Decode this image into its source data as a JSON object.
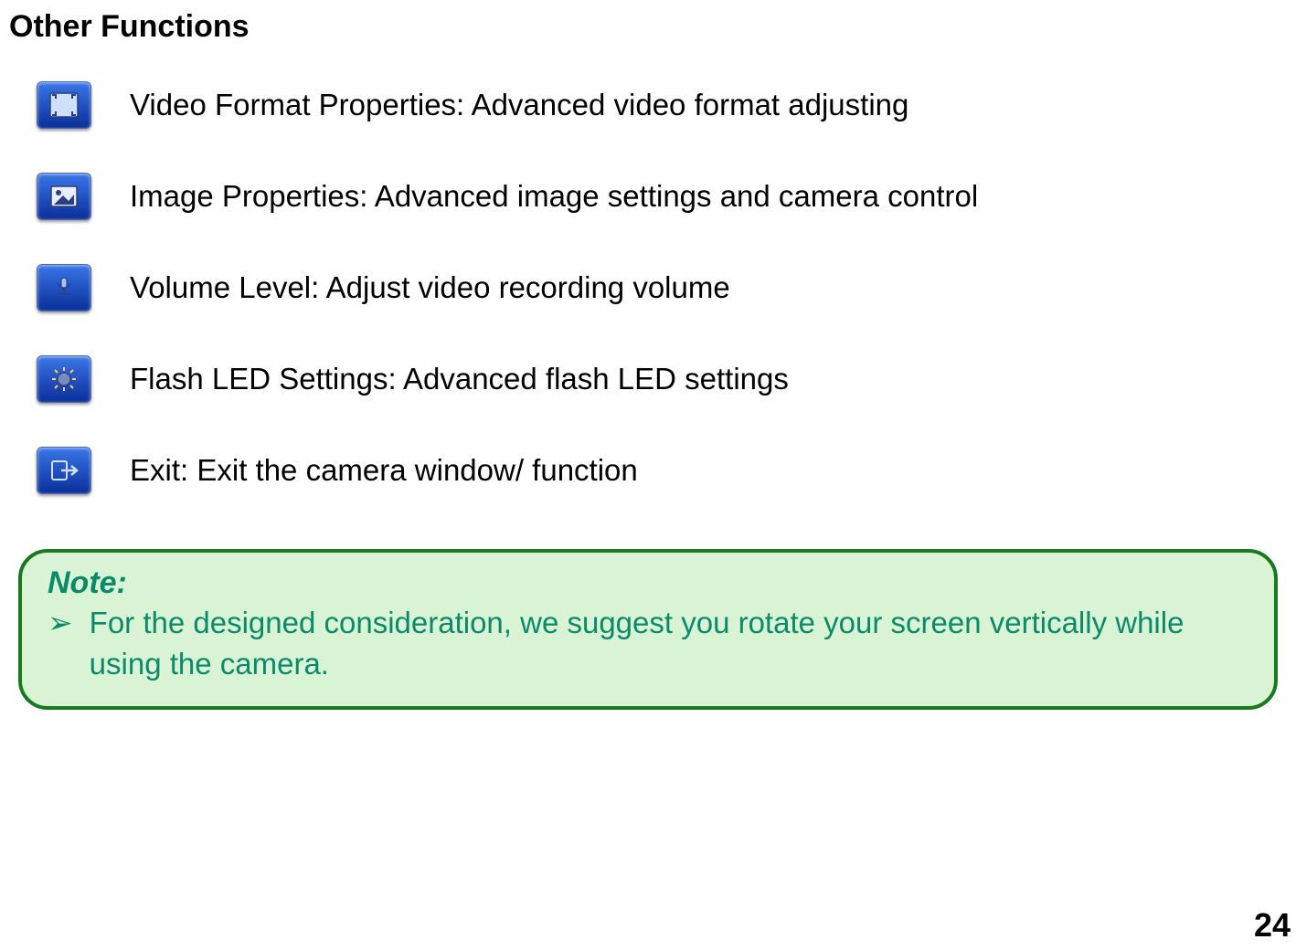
{
  "title": "Other Functions",
  "functions": [
    {
      "icon": "video-format-icon",
      "text": "Video Format Properties: Advanced video format adjusting"
    },
    {
      "icon": "image-properties-icon",
      "text": "Image Properties: Advanced image settings and camera control"
    },
    {
      "icon": "volume-level-icon",
      "text": "Volume Level: Adjust video recording volume"
    },
    {
      "icon": "flash-led-icon",
      "text": "Flash LED Settings: Advanced flash LED settings"
    },
    {
      "icon": "exit-icon",
      "text": "Exit: Exit the camera window/ function"
    }
  ],
  "note": {
    "label": "Note:",
    "bullet": "➢",
    "text": "For the designed consideration, we suggest you rotate your screen vertically while using the camera."
  },
  "page_number": "24"
}
